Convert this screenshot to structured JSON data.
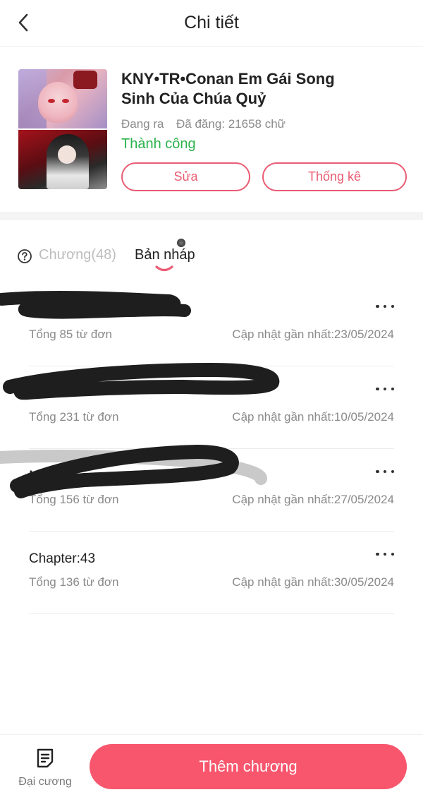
{
  "header": {
    "title": "Chi tiết",
    "back_icon": "chevron-left-icon"
  },
  "book": {
    "title": "KNY•TR•Conan Em Gái Song Sinh Của Chúa Quỷ",
    "status": "Đang ra",
    "word_count": "Đã đăng: 21658 chữ",
    "publish_state": "Thành công",
    "edit_label": "Sửa",
    "stats_label": "Thống kê",
    "accent_color": "#e95c73",
    "success_color": "#2bb24c"
  },
  "tabs": {
    "help_icon": "question-circle-icon",
    "chapters": "Chương(48)",
    "drafts": "Bản nháp"
  },
  "drafts": [
    {
      "title": "",
      "words": "Tổng 85 từ đơn",
      "updated": "Cập nhật gần nhất:23/05/2024",
      "redacted": true
    },
    {
      "title": "",
      "words": "Tổng 231 từ đơn",
      "updated": "Cập nhật gần nhất:10/05/2024",
      "redacted": true
    },
    {
      "title": "N",
      "words": "Tổng 156 từ đơn",
      "updated": "Cập nhật gần nhất:27/05/2024",
      "redacted": true
    },
    {
      "title": "Chapter:43",
      "words": "Tổng 136 từ đơn",
      "updated": "Cập nhật gần nhất:30/05/2024",
      "redacted": false
    }
  ],
  "bottom": {
    "outline_icon": "document-list-icon",
    "outline_label": "Đại cương",
    "add_label": "Thêm chương",
    "add_color": "#f7566d"
  }
}
